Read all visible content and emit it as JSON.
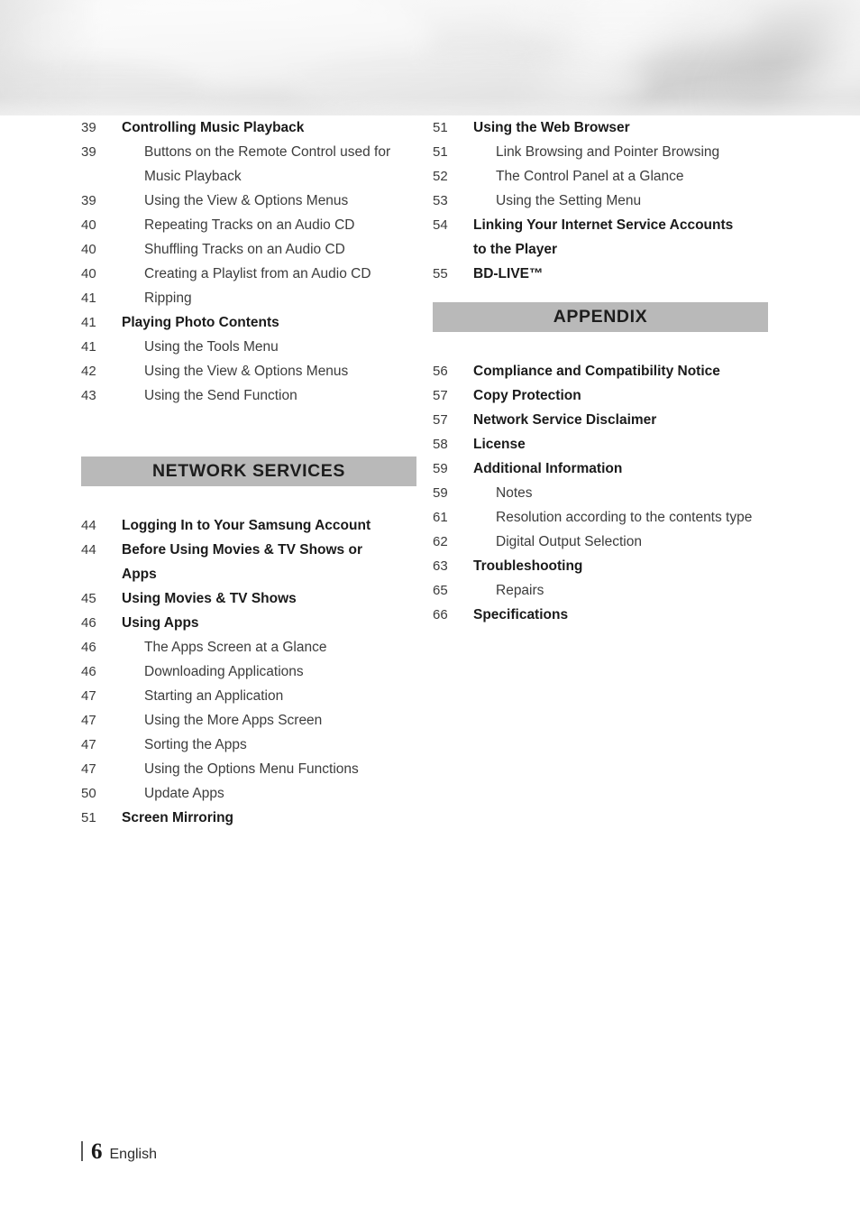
{
  "document": {
    "footer": {
      "page_number": "6",
      "language": "English"
    }
  },
  "columns": {
    "left": {
      "entries": [
        {
          "page": "39",
          "title": "Controlling Music Playback",
          "level": 1
        },
        {
          "page": "39",
          "title": "Buttons on the Remote Control used for Music Playback",
          "level": 2
        },
        {
          "page": "39",
          "title": "Using the View & Options Menus",
          "level": 2
        },
        {
          "page": "40",
          "title": "Repeating Tracks on an Audio CD",
          "level": 2
        },
        {
          "page": "40",
          "title": "Shuffling Tracks on an Audio CD",
          "level": 2
        },
        {
          "page": "40",
          "title": "Creating a Playlist from an Audio CD",
          "level": 2
        },
        {
          "page": "41",
          "title": "Ripping",
          "level": 2
        },
        {
          "page": "41",
          "title": "Playing Photo Contents",
          "level": 1
        },
        {
          "page": "41",
          "title": "Using the Tools Menu",
          "level": 2
        },
        {
          "page": "42",
          "title": "Using the View & Options Menus",
          "level": 2
        },
        {
          "page": "43",
          "title": "Using the Send Function",
          "level": 2
        }
      ],
      "section": {
        "heading": "NETWORK SERVICES",
        "entries": [
          {
            "page": "44",
            "title": "Logging In to Your Samsung Account",
            "level": 1
          },
          {
            "page": "44",
            "title": "Before Using Movies & TV Shows or Apps",
            "level": 1
          },
          {
            "page": "45",
            "title": "Using Movies & TV Shows",
            "level": 1
          },
          {
            "page": "46",
            "title": "Using Apps",
            "level": 1
          },
          {
            "page": "46",
            "title": "The Apps Screen at a Glance",
            "level": 2
          },
          {
            "page": "46",
            "title": "Downloading Applications",
            "level": 2
          },
          {
            "page": "47",
            "title": "Starting an Application",
            "level": 2
          },
          {
            "page": "47",
            "title": "Using the More Apps Screen",
            "level": 2
          },
          {
            "page": "47",
            "title": "Sorting the Apps",
            "level": 2
          },
          {
            "page": "47",
            "title": "Using the Options Menu Functions",
            "level": 2
          },
          {
            "page": "50",
            "title": "Update Apps",
            "level": 2
          },
          {
            "page": "51",
            "title": "Screen Mirroring",
            "level": 1
          }
        ]
      }
    },
    "right": {
      "entries": [
        {
          "page": "51",
          "title": "Using the Web Browser",
          "level": 1
        },
        {
          "page": "51",
          "title": "Link Browsing and Pointer Browsing",
          "level": 2
        },
        {
          "page": "52",
          "title": "The Control Panel at a Glance",
          "level": 2
        },
        {
          "page": "53",
          "title": "Using the Setting Menu",
          "level": 2
        },
        {
          "page": "54",
          "title": "Linking Your Internet Service Accounts to the Player",
          "level": 1
        },
        {
          "page": "55",
          "title": "BD-LIVE™",
          "level": 1
        }
      ],
      "section": {
        "heading": "APPENDIX",
        "entries": [
          {
            "page": "56",
            "title": "Compliance and Compatibility Notice",
            "level": 1
          },
          {
            "page": "57",
            "title": "Copy Protection",
            "level": 1
          },
          {
            "page": "57",
            "title": "Network Service Disclaimer",
            "level": 1
          },
          {
            "page": "58",
            "title": "License",
            "level": 1
          },
          {
            "page": "59",
            "title": "Additional Information",
            "level": 1
          },
          {
            "page": "59",
            "title": "Notes",
            "level": 2
          },
          {
            "page": "61",
            "title": "Resolution according to the contents type",
            "level": 2
          },
          {
            "page": "62",
            "title": "Digital Output Selection",
            "level": 2
          },
          {
            "page": "63",
            "title": "Troubleshooting",
            "level": 1
          },
          {
            "page": "65",
            "title": "Repairs",
            "level": 2
          },
          {
            "page": "66",
            "title": "Specifications",
            "level": 1
          }
        ]
      }
    }
  },
  "colors": {
    "section_bar": "#b9b9b9",
    "heading_text": "#1a1a1a",
    "body_text": "#3c3c3c",
    "page_number": "#3b3b3b",
    "banner_base": "#e9e9e9"
  }
}
